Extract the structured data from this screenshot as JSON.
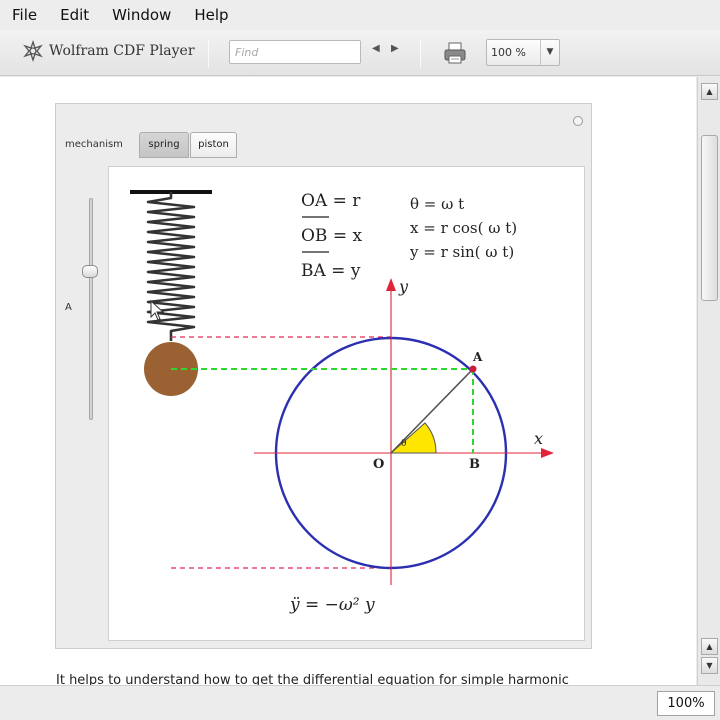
{
  "menu": [
    "File",
    "Edit",
    "Window",
    "Help"
  ],
  "toolbar": {
    "brand_label": "Wolfram CDF Player",
    "find_placeholder": "Find",
    "prev_label": "◀",
    "next_label": "▶",
    "zoom_value": "100 %",
    "zoom_arrow": "▼"
  },
  "panel": {
    "control_label": "mechanism",
    "tabs": [
      {
        "label": "spring",
        "selected": true
      },
      {
        "label": "piston",
        "selected": false
      }
    ],
    "slider_label": "A",
    "slider_level": 0.33
  },
  "plot": {
    "eq_left": [
      "OA = r",
      "OB = x",
      "BA = y"
    ],
    "eq_right": [
      "θ = ω t",
      "x = r cos( ω t)",
      "y = r sin( ω t)"
    ],
    "axis_x_label": "x",
    "axis_y_label": "y",
    "origin_label": "O",
    "point_a_label": "A",
    "point_b_label": "B",
    "angle_label": "θ",
    "bottom_equation": "ÿ = −ω² y",
    "colors": {
      "circle": "#2b2fb0",
      "axes": "#e0243a",
      "mass": "#9a6133",
      "guide": "#e52a5a",
      "projection": "#2fd62f",
      "angle_fill": "#ffe600"
    }
  },
  "document_text": "It helps to understand how to get the differential equation for simple harmonic",
  "scrollbar": {
    "up": "▲",
    "down": "▼"
  },
  "status": {
    "zoom": "100%"
  }
}
